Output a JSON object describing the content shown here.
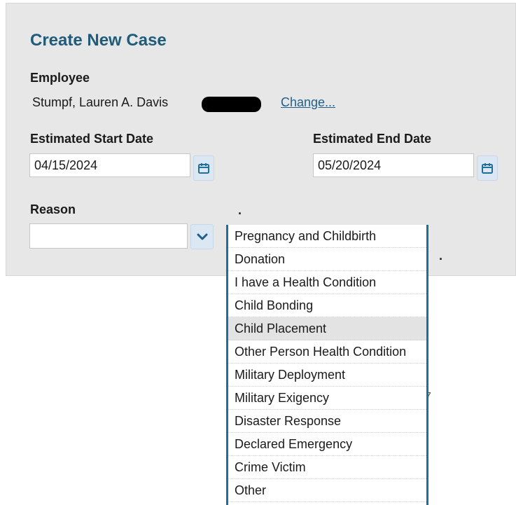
{
  "form": {
    "title": "Create New Case",
    "employee_label": "Employee",
    "employee_name": "Stumpf, Lauren A. Davis",
    "change_link": "Change...",
    "start_date_label": "Estimated Start Date",
    "start_date_value": "04/15/2024",
    "end_date_label": "Estimated End Date",
    "end_date_value": "05/20/2024",
    "reason_label": "Reason",
    "reason_value": ""
  },
  "reason_options": [
    "Pregnancy and Childbirth",
    "Donation",
    "I have a Health Condition",
    "Child Bonding",
    "Child Placement",
    "Other Person Health Condition",
    "Military Deployment",
    "Military Exigency",
    "Disaster Response",
    "Declared Emergency",
    "Crime Victim",
    "Other"
  ],
  "highlighted_option": "Child Placement",
  "colors": {
    "heading": "#1f5b7a",
    "link": "#1f5f8b",
    "panel_bg": "#e7e7e7",
    "button_bg": "#dbe8f4",
    "dropdown_border": "#1f6f99",
    "hover_bg": "#e3e3e3"
  },
  "icons": {
    "calendar": "calendar-icon",
    "dropdown": "chevron-down-icon"
  }
}
